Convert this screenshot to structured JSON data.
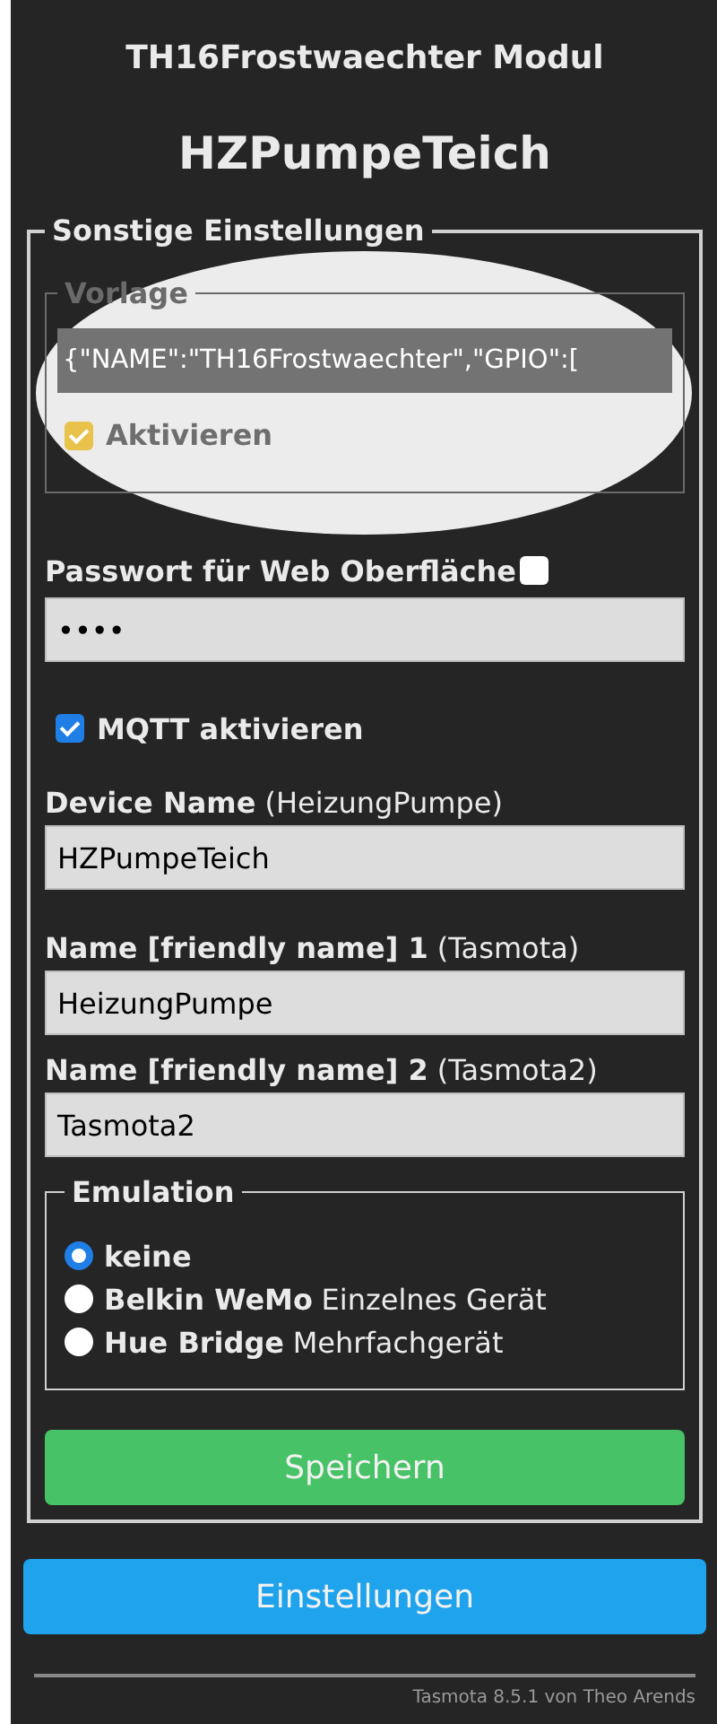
{
  "header": {
    "module": "TH16Frostwaechter Modul",
    "device": "HZPumpeTeich"
  },
  "settings": {
    "legend": "Sonstige Einstellungen",
    "template": {
      "legend": "Vorlage",
      "value": "{\"NAME\":\"TH16Frostwaechter\",\"GPIO\":[",
      "activate": {
        "label": "Aktivieren",
        "checked": true
      }
    },
    "password": {
      "label": "Passwort für Web Oberfläche",
      "show_checked": false,
      "value": "••••"
    },
    "mqtt": {
      "label": "MQTT aktivieren",
      "checked": true
    },
    "fields": [
      {
        "label": "Device Name",
        "hint": "(HeizungPumpe)",
        "value": "HZPumpeTeich"
      },
      {
        "label": "Name [friendly name] 1",
        "hint": "(Tasmota)",
        "value": "HeizungPumpe"
      },
      {
        "label": "Name [friendly name] 2",
        "hint": "(Tasmota2)",
        "value": "Tasmota2"
      }
    ],
    "emulation": {
      "legend": "Emulation",
      "options": [
        {
          "label": "keine",
          "selected": true
        },
        {
          "label": "Belkin WeMo",
          "detail": "Einzelnes Gerät",
          "selected": false
        },
        {
          "label": "Hue Bridge",
          "detail": "Mehrfachgerät",
          "selected": false
        }
      ]
    },
    "save_button": "Speichern"
  },
  "settings_button": "Einstellungen",
  "footer": "Tasmota 8.5.1 von Theo Arends",
  "highlight": {
    "kind": "ellipse"
  }
}
